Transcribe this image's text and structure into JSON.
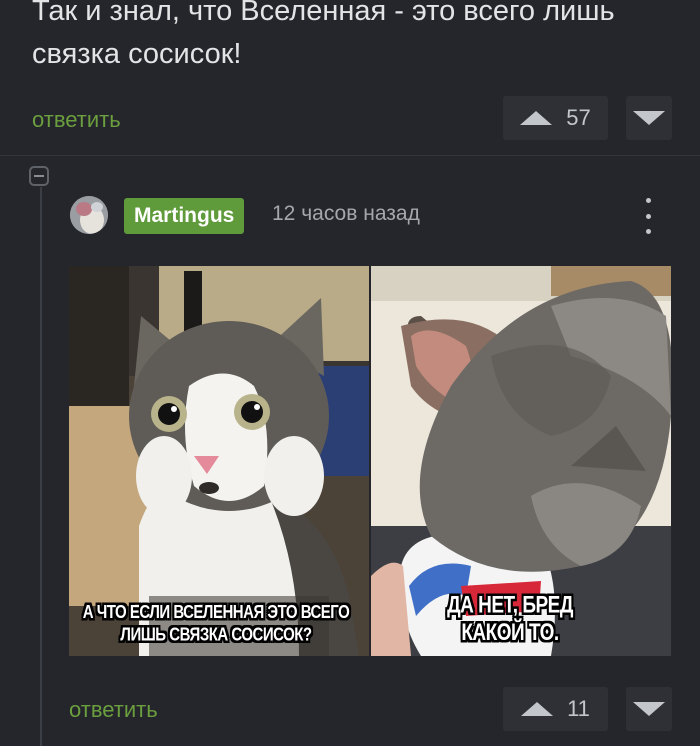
{
  "parent_comment": {
    "text": "Так и знал, что Вселенная - это всего лишь связка сосисок!",
    "reply_label": "ответить",
    "votes": "57"
  },
  "comment": {
    "username": "Martingus",
    "timestamp": "12 часов назад",
    "meme": {
      "left_caption": "А что если вселенная это всего лишь связка сосисок?",
      "right_caption": "Да нет, бред какой то."
    },
    "reply_label": "ответить",
    "votes": "11"
  },
  "colors": {
    "background": "#24262b",
    "accent_green": "#5f9a3b",
    "reply_green": "#6b9e3e",
    "text": "#e3e4e6"
  },
  "icons": [
    "upvote-icon",
    "downvote-icon",
    "collapse-icon",
    "more-icon"
  ]
}
